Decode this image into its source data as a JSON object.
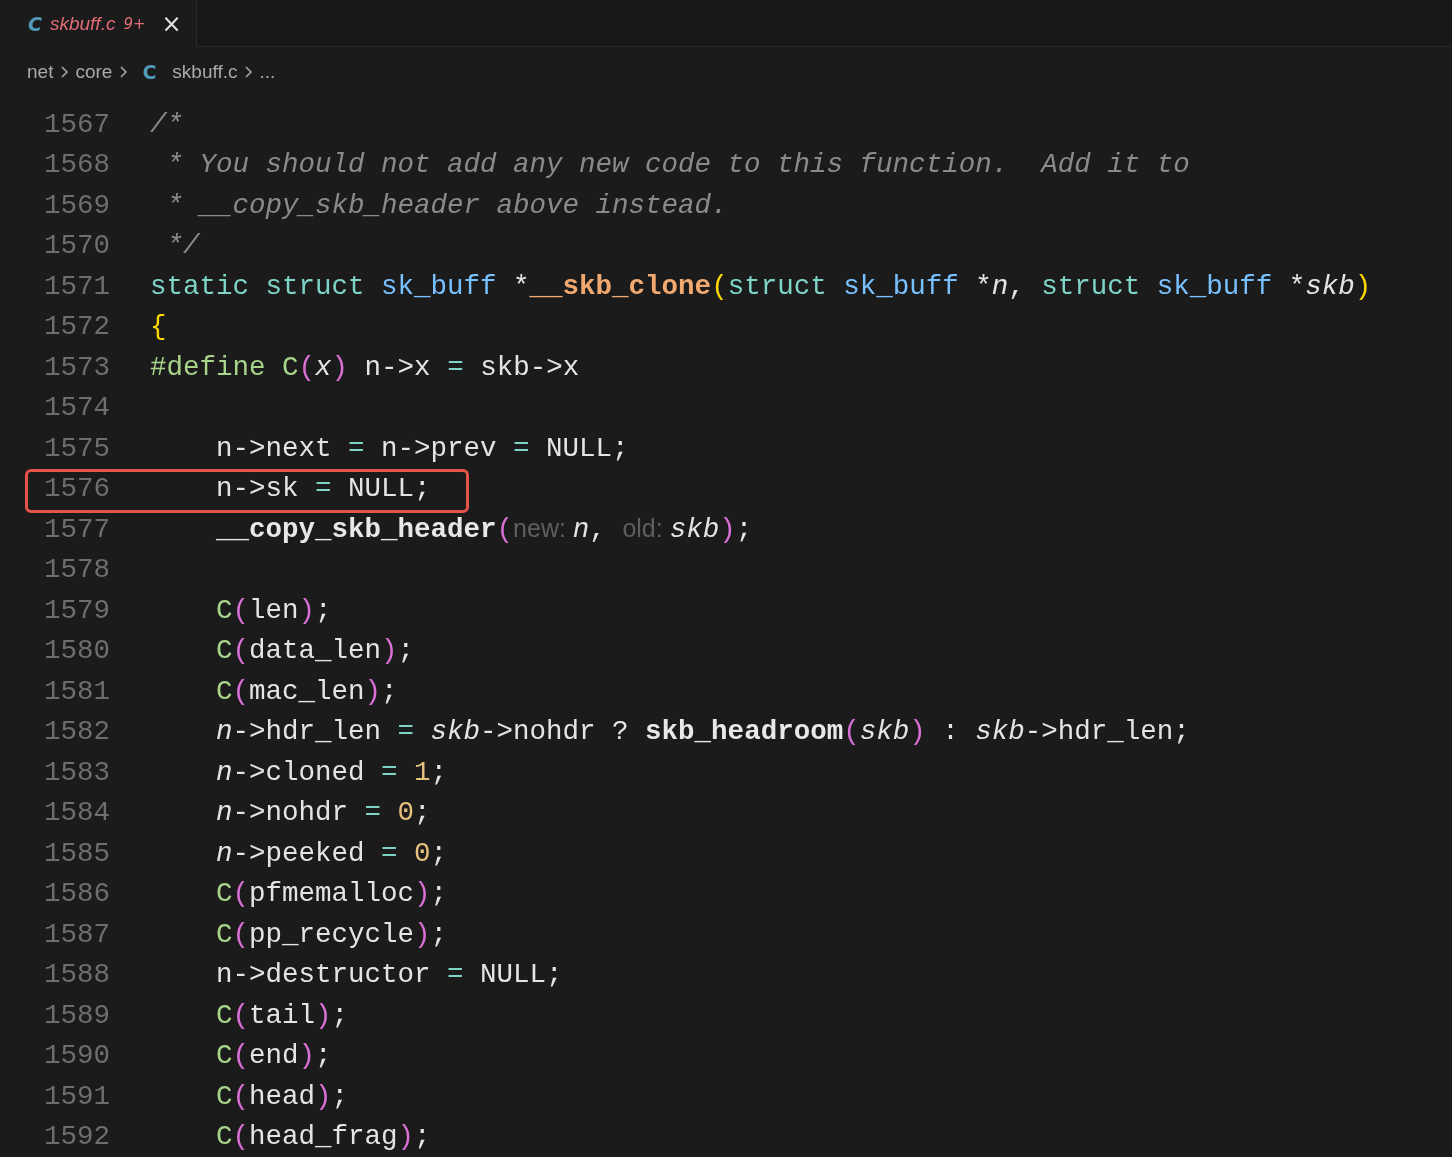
{
  "tab": {
    "icon": "C",
    "label": "skbuff.c",
    "problems": "9+",
    "close": "×"
  },
  "breadcrumbs": [
    {
      "kind": "folder",
      "label": "net"
    },
    {
      "kind": "folder",
      "label": "core"
    },
    {
      "kind": "file",
      "icon": "C",
      "label": "skbuff.c"
    },
    {
      "kind": "more",
      "label": "..."
    }
  ],
  "lines": [
    {
      "number": "1567",
      "boxed": false,
      "tokens": [
        {
          "kind": "comment",
          "text": "/*"
        }
      ]
    },
    {
      "number": "1568",
      "boxed": false,
      "tokens": [
        {
          "kind": "comment",
          "text": " * You should not add any new code to this function.  Add it to"
        }
      ]
    },
    {
      "number": "1569",
      "boxed": false,
      "tokens": [
        {
          "kind": "comment",
          "text": " * __copy_skb_header above instead."
        }
      ]
    },
    {
      "number": "1570",
      "boxed": false,
      "tokens": [
        {
          "kind": "comment",
          "text": " */"
        }
      ]
    },
    {
      "number": "1571",
      "boxed": false,
      "tokens": [
        {
          "kind": "kw",
          "text": "static struct "
        },
        {
          "kind": "type",
          "text": "sk_buff"
        },
        {
          "kind": "text",
          "text": " *"
        },
        {
          "kind": "fn-def",
          "text": "__skb_clone"
        },
        {
          "kind": "paren-a",
          "text": "("
        },
        {
          "kind": "kw",
          "text": "struct "
        },
        {
          "kind": "type",
          "text": "sk_buff"
        },
        {
          "kind": "text",
          "text": " *"
        },
        {
          "kind": "param",
          "text": "n"
        },
        {
          "kind": "text",
          "text": ", "
        },
        {
          "kind": "kw",
          "text": "struct "
        },
        {
          "kind": "type",
          "text": "sk_buff"
        },
        {
          "kind": "text",
          "text": " *"
        },
        {
          "kind": "param",
          "text": "skb"
        },
        {
          "kind": "paren-a",
          "text": ")"
        }
      ]
    },
    {
      "number": "1572",
      "boxed": false,
      "tokens": [
        {
          "kind": "paren-a",
          "text": "{"
        }
      ]
    },
    {
      "number": "1573",
      "boxed": false,
      "tokens": [
        {
          "kind": "preproc",
          "text": "#define "
        },
        {
          "kind": "macro",
          "text": "C"
        },
        {
          "kind": "paren-b",
          "text": "("
        },
        {
          "kind": "param",
          "text": "x"
        },
        {
          "kind": "paren-b",
          "text": ")"
        },
        {
          "kind": "text",
          "text": " n->x "
        },
        {
          "kind": "op",
          "text": "="
        },
        {
          "kind": "text",
          "text": " skb->x"
        }
      ]
    },
    {
      "number": "1574",
      "boxed": false
    },
    {
      "number": "1575",
      "boxed": false,
      "tokens": [
        {
          "kind": "text",
          "text": "    n->next "
        },
        {
          "kind": "op",
          "text": "="
        },
        {
          "kind": "text",
          "text": " n->prev "
        },
        {
          "kind": "op",
          "text": "="
        },
        {
          "kind": "text",
          "text": " NULL;"
        }
      ]
    },
    {
      "number": "1576",
      "boxed": true,
      "tokens": [
        {
          "kind": "text",
          "text": "    n->sk "
        },
        {
          "kind": "op",
          "text": "="
        },
        {
          "kind": "text",
          "text": " NULL;"
        }
      ]
    },
    {
      "number": "1577",
      "boxed": false,
      "tokens": [
        {
          "kind": "fn-call",
          "text": "    __copy_skb_header"
        },
        {
          "kind": "paren-b",
          "text": "("
        },
        {
          "kind": "hint",
          "text": "new: "
        },
        {
          "kind": "param",
          "text": "n"
        },
        {
          "kind": "text",
          "text": ", "
        },
        {
          "kind": "hint",
          "text": "old: "
        },
        {
          "kind": "param",
          "text": "skb"
        },
        {
          "kind": "paren-b",
          "text": ")"
        },
        {
          "kind": "text",
          "text": ";"
        }
      ]
    },
    {
      "number": "1578",
      "boxed": false
    },
    {
      "number": "1579",
      "boxed": false,
      "tokens": [
        {
          "kind": "macro",
          "text": "    C"
        },
        {
          "kind": "paren-b",
          "text": "("
        },
        {
          "kind": "text",
          "text": "len"
        },
        {
          "kind": "paren-b",
          "text": ")"
        },
        {
          "kind": "text",
          "text": ";"
        }
      ]
    },
    {
      "number": "1580",
      "boxed": false,
      "tokens": [
        {
          "kind": "macro",
          "text": "    C"
        },
        {
          "kind": "paren-b",
          "text": "("
        },
        {
          "kind": "text",
          "text": "data_len"
        },
        {
          "kind": "paren-b",
          "text": ")"
        },
        {
          "kind": "text",
          "text": ";"
        }
      ]
    },
    {
      "number": "1581",
      "boxed": false,
      "tokens": [
        {
          "kind": "macro",
          "text": "    C"
        },
        {
          "kind": "paren-b",
          "text": "("
        },
        {
          "kind": "text",
          "text": "mac_len"
        },
        {
          "kind": "paren-b",
          "text": ")"
        },
        {
          "kind": "text",
          "text": ";"
        }
      ]
    },
    {
      "number": "1582",
      "boxed": false,
      "tokens": [
        {
          "kind": "param",
          "text": "    n"
        },
        {
          "kind": "text",
          "text": "->hdr_len "
        },
        {
          "kind": "op",
          "text": "= "
        },
        {
          "kind": "param",
          "text": "skb"
        },
        {
          "kind": "text",
          "text": "->nohdr ? "
        },
        {
          "kind": "fn-call",
          "text": "skb_headroom"
        },
        {
          "kind": "paren-b",
          "text": "("
        },
        {
          "kind": "param",
          "text": "skb"
        },
        {
          "kind": "paren-b",
          "text": ")"
        },
        {
          "kind": "text",
          "text": " : "
        },
        {
          "kind": "param",
          "text": "skb"
        },
        {
          "kind": "text",
          "text": "->hdr_len;"
        }
      ]
    },
    {
      "number": "1583",
      "boxed": false,
      "tokens": [
        {
          "kind": "param",
          "text": "    n"
        },
        {
          "kind": "text",
          "text": "->cloned "
        },
        {
          "kind": "op",
          "text": "= "
        },
        {
          "kind": "num",
          "text": "1"
        },
        {
          "kind": "text",
          "text": ";"
        }
      ]
    },
    {
      "number": "1584",
      "boxed": false,
      "tokens": [
        {
          "kind": "param",
          "text": "    n"
        },
        {
          "kind": "text",
          "text": "->nohdr "
        },
        {
          "kind": "op",
          "text": "= "
        },
        {
          "kind": "num",
          "text": "0"
        },
        {
          "kind": "text",
          "text": ";"
        }
      ]
    },
    {
      "number": "1585",
      "boxed": false,
      "tokens": [
        {
          "kind": "param",
          "text": "    n"
        },
        {
          "kind": "text",
          "text": "->peeked "
        },
        {
          "kind": "op",
          "text": "= "
        },
        {
          "kind": "num",
          "text": "0"
        },
        {
          "kind": "text",
          "text": ";"
        }
      ]
    },
    {
      "number": "1586",
      "boxed": false,
      "tokens": [
        {
          "kind": "macro",
          "text": "    C"
        },
        {
          "kind": "paren-b",
          "text": "("
        },
        {
          "kind": "text",
          "text": "pfmemalloc"
        },
        {
          "kind": "paren-b",
          "text": ")"
        },
        {
          "kind": "text",
          "text": ";"
        }
      ]
    },
    {
      "number": "1587",
      "boxed": false,
      "tokens": [
        {
          "kind": "macro",
          "text": "    C"
        },
        {
          "kind": "paren-b",
          "text": "("
        },
        {
          "kind": "text",
          "text": "pp_recycle"
        },
        {
          "kind": "paren-b",
          "text": ")"
        },
        {
          "kind": "text",
          "text": ";"
        }
      ]
    },
    {
      "number": "1588",
      "boxed": false,
      "tokens": [
        {
          "kind": "text",
          "text": "    n->destructor "
        },
        {
          "kind": "op",
          "text": "="
        },
        {
          "kind": "text",
          "text": " NULL;"
        }
      ]
    },
    {
      "number": "1589",
      "boxed": false,
      "tokens": [
        {
          "kind": "macro",
          "text": "    C"
        },
        {
          "kind": "paren-b",
          "text": "("
        },
        {
          "kind": "text",
          "text": "tail"
        },
        {
          "kind": "paren-b",
          "text": ")"
        },
        {
          "kind": "text",
          "text": ";"
        }
      ]
    },
    {
      "number": "1590",
      "boxed": false,
      "tokens": [
        {
          "kind": "macro",
          "text": "    C"
        },
        {
          "kind": "paren-b",
          "text": "("
        },
        {
          "kind": "text",
          "text": "end"
        },
        {
          "kind": "paren-b",
          "text": ")"
        },
        {
          "kind": "text",
          "text": ";"
        }
      ]
    },
    {
      "number": "1591",
      "boxed": false,
      "tokens": [
        {
          "kind": "macro",
          "text": "    C"
        },
        {
          "kind": "paren-b",
          "text": "("
        },
        {
          "kind": "text",
          "text": "head"
        },
        {
          "kind": "paren-b",
          "text": ")"
        },
        {
          "kind": "text",
          "text": ";"
        }
      ]
    },
    {
      "number": "1592",
      "boxed": false,
      "tokens": [
        {
          "kind": "macro",
          "text": "    C"
        },
        {
          "kind": "paren-b",
          "text": "("
        },
        {
          "kind": "text",
          "text": "head_frag"
        },
        {
          "kind": "paren-b",
          "text": ")"
        },
        {
          "kind": "text",
          "text": ";"
        }
      ]
    }
  ]
}
